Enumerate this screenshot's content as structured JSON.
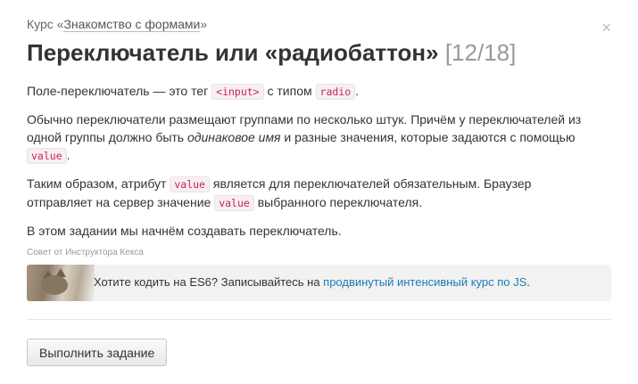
{
  "breadcrumb": {
    "prefix": "Курс «",
    "course_link": "Знакомство с формами",
    "suffix": "»"
  },
  "close_label": "×",
  "title": {
    "text": "Переключатель или «радиобаттон»",
    "counter": "[12/18]"
  },
  "content": {
    "p1": {
      "t1": "Поле-переключатель — это тег ",
      "c1": "<input>",
      "t2": " с типом ",
      "c2": "radio",
      "t3": "."
    },
    "p2": {
      "t1": "Обычно переключатели размещают группами по несколько штук. Причём у переключателей из одной группы должно быть ",
      "em": "одинаковое имя",
      "t2": " и разные значения, которые задаются с помощью ",
      "c1": "value",
      "t3": "."
    },
    "p3": {
      "t1": "Таким образом, атрибут ",
      "c1": "value",
      "t2": " является для переключателей обязательным. Браузер отправляет на сервер значение ",
      "c2": "value",
      "t3": " выбранного переключателя."
    },
    "p4": "В этом задании мы начнём создавать переключатель."
  },
  "tip": {
    "label": "Совет от Инструктора Кекса",
    "text": "Хотите кодить на ES6? Записывайтесь на ",
    "link": "продвинутый интенсивный курс по JS",
    "end": "."
  },
  "button_label": "Выполнить задание"
}
